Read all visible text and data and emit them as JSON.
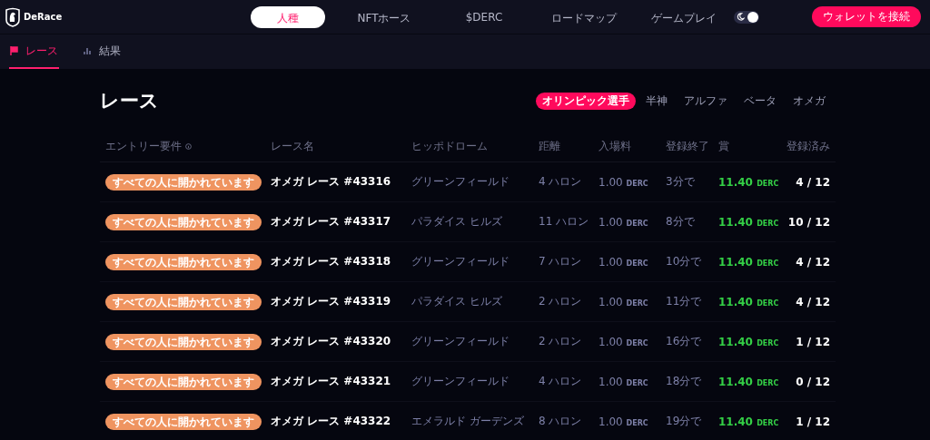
{
  "header": {
    "brand": "DeRace",
    "nav": [
      {
        "label": "人種",
        "selected": true
      },
      {
        "label": "NFTホース",
        "selected": false
      },
      {
        "label": "$DERC",
        "selected": false
      },
      {
        "label": "ロードマップ",
        "selected": false
      },
      {
        "label": "ゲームプレイ",
        "selected": false
      }
    ],
    "dark_mode": {
      "on": true
    },
    "connect_button": "ウォレットを接続"
  },
  "subnav": [
    {
      "label": "レース",
      "selected": true
    },
    {
      "label": "結果",
      "selected": false
    }
  ],
  "title": "レース",
  "classes": [
    {
      "label": "オリンピック選手",
      "selected": true
    },
    {
      "label": "半神",
      "selected": false
    },
    {
      "label": "アルファ",
      "selected": false
    },
    {
      "label": "ベータ",
      "selected": false
    },
    {
      "label": "オメガ",
      "selected": false
    }
  ],
  "table": {
    "columns": [
      "エントリー要件",
      "レース名",
      "ヒッポドローム",
      "距離",
      "入場料",
      "登録終了",
      "賞",
      "登録済み"
    ],
    "rows": [
      {
        "entry": "すべての人に開かれています",
        "name": "オメガ レース #43316",
        "hippodrome": "グリーンフィールド",
        "distance": "4 ハロン",
        "fee": "1.00",
        "fee_unit": "DERC",
        "closes": "3分で",
        "prize": "11.40",
        "prize_unit": "DERC",
        "registered": "4 / 12"
      },
      {
        "entry": "すべての人に開かれています",
        "name": "オメガ レース #43317",
        "hippodrome": "パラダイス ヒルズ",
        "distance": "11 ハロン",
        "fee": "1.00",
        "fee_unit": "DERC",
        "closes": "8分で",
        "prize": "11.40",
        "prize_unit": "DERC",
        "registered": "10 / 12"
      },
      {
        "entry": "すべての人に開かれています",
        "name": "オメガ レース #43318",
        "hippodrome": "グリーンフィールド",
        "distance": "7 ハロン",
        "fee": "1.00",
        "fee_unit": "DERC",
        "closes": "10分で",
        "prize": "11.40",
        "prize_unit": "DERC",
        "registered": "4 / 12"
      },
      {
        "entry": "すべての人に開かれています",
        "name": "オメガ レース #43319",
        "hippodrome": "パラダイス ヒルズ",
        "distance": "2 ハロン",
        "fee": "1.00",
        "fee_unit": "DERC",
        "closes": "11分で",
        "prize": "11.40",
        "prize_unit": "DERC",
        "registered": "4 / 12"
      },
      {
        "entry": "すべての人に開かれています",
        "name": "オメガ レース #43320",
        "hippodrome": "グリーンフィールド",
        "distance": "2 ハロン",
        "fee": "1.00",
        "fee_unit": "DERC",
        "closes": "16分で",
        "prize": "11.40",
        "prize_unit": "DERC",
        "registered": "1 / 12"
      },
      {
        "entry": "すべての人に開かれています",
        "name": "オメガ レース #43321",
        "hippodrome": "グリーンフィールド",
        "distance": "4 ハロン",
        "fee": "1.00",
        "fee_unit": "DERC",
        "closes": "18分で",
        "prize": "11.40",
        "prize_unit": "DERC",
        "registered": "0 / 12"
      },
      {
        "entry": "すべての人に開かれています",
        "name": "オメガ レース #43322",
        "hippodrome": "エメラルド ガーデンズ",
        "distance": "8 ハロン",
        "fee": "1.00",
        "fee_unit": "DERC",
        "closes": "19分で",
        "prize": "11.40",
        "prize_unit": "DERC",
        "registered": "1 / 12"
      }
    ]
  }
}
